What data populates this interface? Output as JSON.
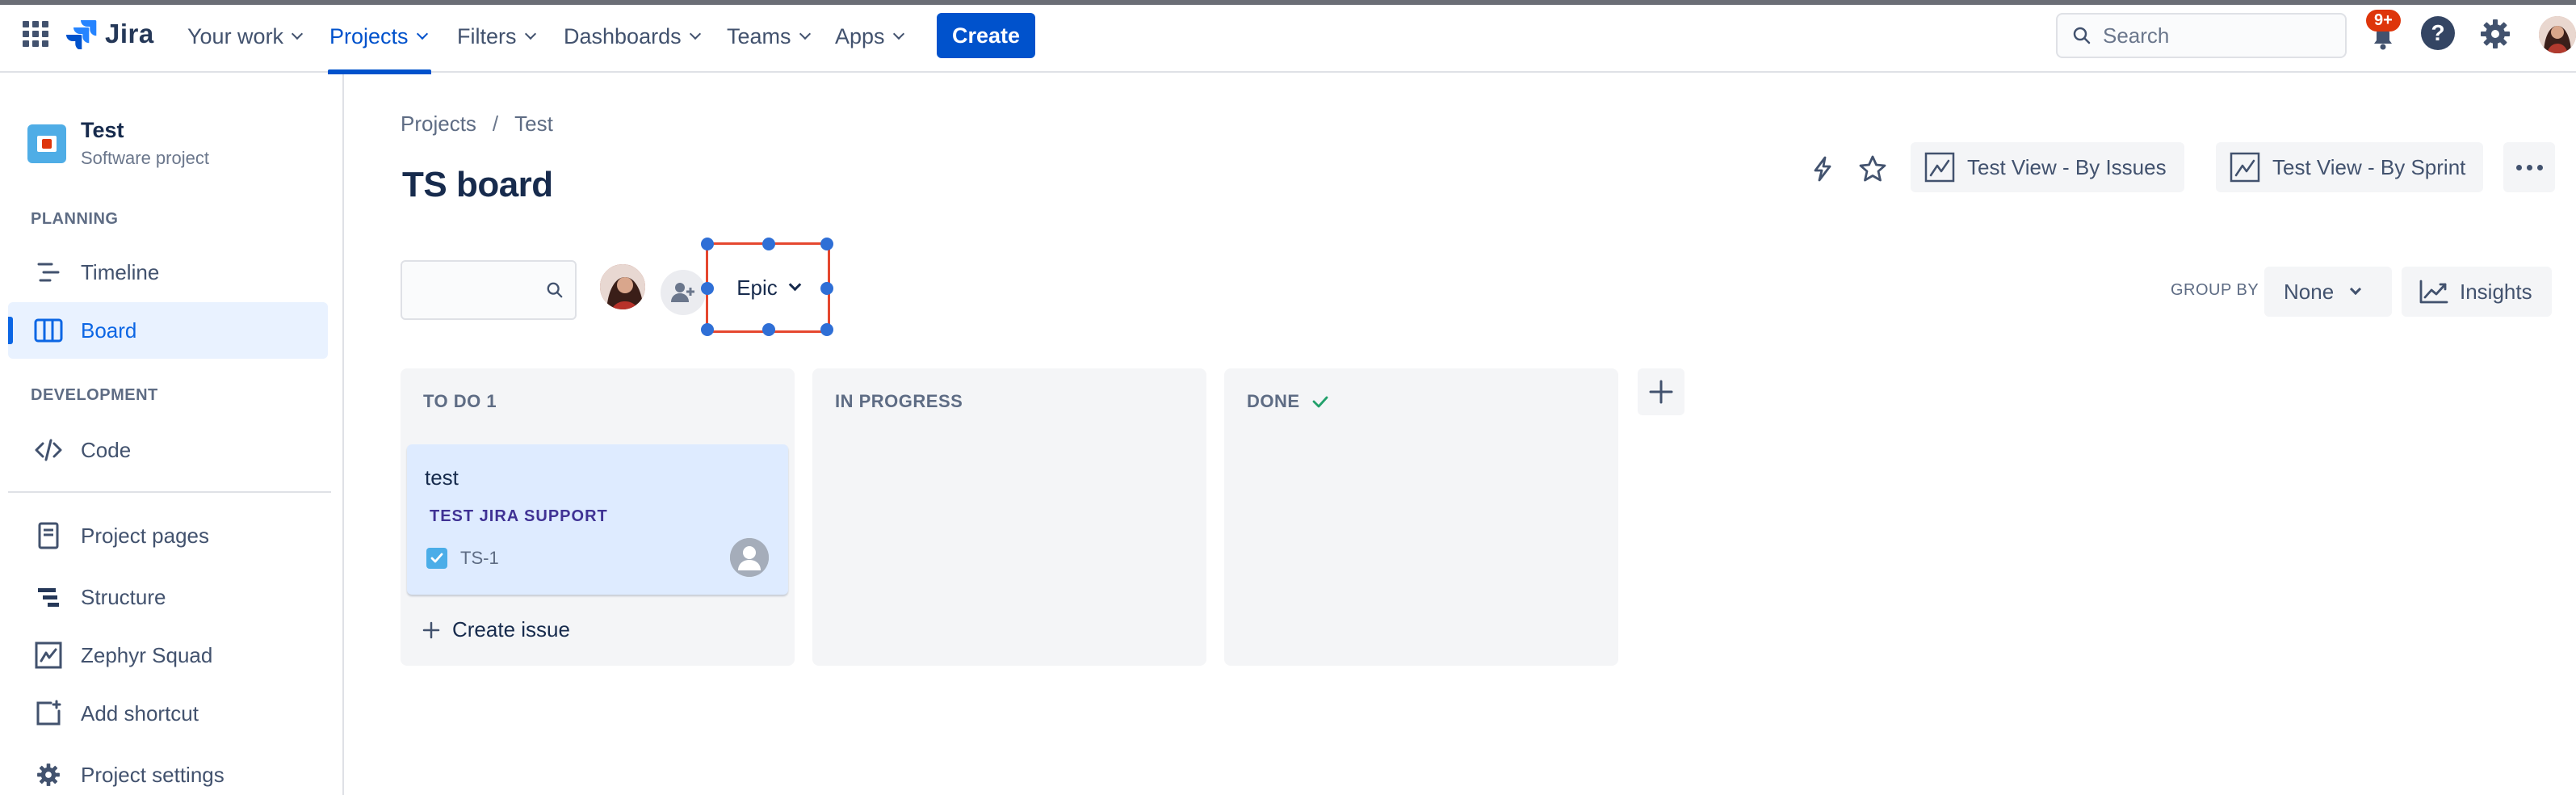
{
  "nav": {
    "logo": "Jira",
    "items": [
      {
        "label": "Your work"
      },
      {
        "label": "Projects"
      },
      {
        "label": "Filters"
      },
      {
        "label": "Dashboards"
      },
      {
        "label": "Teams"
      },
      {
        "label": "Apps"
      }
    ],
    "active_item": "Projects",
    "create_label": "Create",
    "search_placeholder": "Search",
    "notifications_badge": "9+",
    "help_glyph": "?",
    "accent": "#0052CC"
  },
  "sidebar": {
    "project_name": "Test",
    "project_type": "Software project",
    "planning_label": "PLANNING",
    "development_label": "DEVELOPMENT",
    "items": [
      {
        "label": "Timeline",
        "icon": "timeline-icon"
      },
      {
        "label": "Board",
        "icon": "board-icon",
        "active": true
      },
      {
        "label": "Code",
        "icon": "code-icon"
      },
      {
        "label": "Project pages",
        "icon": "pages-icon"
      },
      {
        "label": "Structure",
        "icon": "structure-icon"
      },
      {
        "label": "Zephyr Squad",
        "icon": "zephyr-icon"
      },
      {
        "label": "Add shortcut",
        "icon": "add-shortcut-icon"
      },
      {
        "label": "Project settings",
        "icon": "gear-icon"
      }
    ]
  },
  "main": {
    "breadcrumb": [
      "Projects",
      "Test"
    ],
    "breadcrumb_sep": "/",
    "title": "TS board",
    "view_by_issues": "Test View - By Issues",
    "view_by_sprint": "Test View - By Sprint",
    "epic_filter": "Epic",
    "group_by_label": "GROUP BY",
    "group_by_value": "None",
    "insights_label": "Insights",
    "selection_color": "#E5472F"
  },
  "board": {
    "columns": [
      {
        "title": "TO DO 1"
      },
      {
        "title": "IN PROGRESS"
      },
      {
        "title": "DONE"
      }
    ],
    "card": {
      "title": "test",
      "epic": "TEST JIRA SUPPORT",
      "key": "TS-1"
    },
    "create_issue": "Create issue"
  }
}
